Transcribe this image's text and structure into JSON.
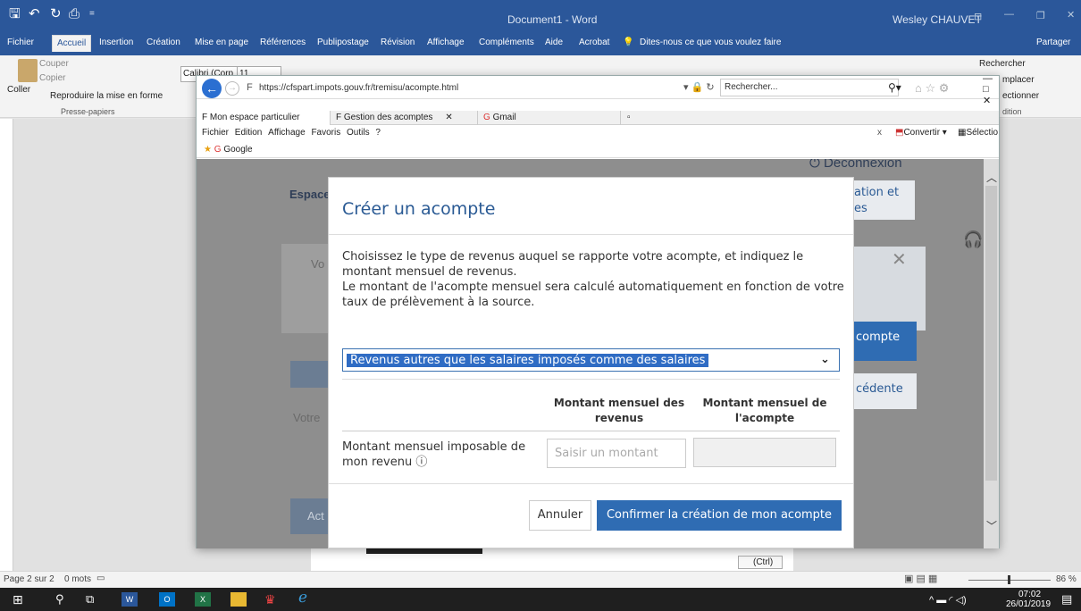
{
  "word": {
    "title": "Document1  -  Word",
    "user": "Wesley CHAUVET",
    "menu": [
      "Fichier",
      "Accueil",
      "Insertion",
      "Création",
      "Mise en page",
      "Références",
      "Publipostage",
      "Révision",
      "Affichage",
      "Compléments",
      "Aide",
      "Acrobat"
    ],
    "tell_me": "Dites-nous ce que vous voulez faire",
    "share": "Partager",
    "clipboard": {
      "paste": "Coller",
      "cut": "Couper",
      "copy": "Copier",
      "format": "Reproduire la mise en forme",
      "group": "Presse-papiers"
    },
    "font_box": "Calibri (Corp",
    "size_box": "11",
    "edit": {
      "find": "Rechercher",
      "replace": "mplacer",
      "select": "ectionner",
      "group": "dition"
    },
    "status": {
      "page": "Page 2 sur 2",
      "words": "0 mots",
      "zoom": "86 %"
    },
    "paste_ctrl": "(Ctrl)"
  },
  "taskbar": {
    "time": "07:02",
    "date": "26/01/2019"
  },
  "ie": {
    "url": "https://cfspart.impots.gouv.fr/tremisu/acompte.html",
    "url_host": "impots.gouv.fr",
    "search_placeholder": "Rechercher...",
    "tabs": [
      "Mon espace particulier",
      "Gestion des acomptes",
      "Gmail"
    ],
    "menu": [
      "Fichier",
      "Edition",
      "Affichage",
      "Favoris",
      "Outils",
      "?"
    ],
    "fav": "Google",
    "toolbar_right": {
      "convert": "Convertir",
      "select": "Sélectio"
    }
  },
  "site": {
    "logout": "Déconnexion",
    "espace": "Espace",
    "vo": "Vo",
    "votre": "Votre",
    "act": "Act",
    "side1": "ation et",
    "side1b": "es",
    "side2": "compte",
    "side3": "cédente"
  },
  "modal": {
    "title": "Créer un acompte",
    "p1": "Choisissez le type de revenus auquel se rapporte votre acompte, et indiquez le",
    "p2": "montant mensuel de revenus.",
    "p3": "Le montant de l'acompte mensuel sera calculé automatiquement en fonction de votre",
    "p4": "taux de prélèvement à la source.",
    "select_value": "Revenus autres que les salaires imposés comme des salaires",
    "col1a": "Montant mensuel des",
    "col1b": "revenus",
    "col2a": "Montant mensuel de",
    "col2b": "l'acompte",
    "row_label_a": "Montant mensuel imposable de",
    "row_label_b": "mon revenu",
    "input_placeholder": "Saisir un montant",
    "cancel": "Annuler",
    "confirm": "Confirmer la création de mon acompte"
  }
}
